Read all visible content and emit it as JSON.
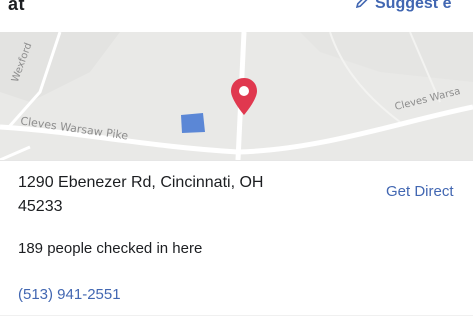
{
  "header": {
    "title_fragment": "at",
    "suggest_edit_label": "Suggest e",
    "pencil_icon": "pencil-icon"
  },
  "map": {
    "road_labels": {
      "wexford": "Wexford",
      "cleves_warsaw_pike": "Cleves Warsaw Pike",
      "cleves_warsaw_right": "Cleves Warsa"
    },
    "pin_icon": "map-pin-icon",
    "pin_color": "#e0384f",
    "building_color": "#5b87d6"
  },
  "info": {
    "address_line1": "1290 Ebenezer Rd, Cincinnati, OH",
    "address_line2": "45233",
    "directions_label": "Get Direct",
    "checkins_text": "189 people checked in here",
    "phone": "(513) 941-2551"
  },
  "colors": {
    "link": "#4267b2",
    "text": "#1c1e21",
    "map_bg": "#e9e9e7"
  }
}
